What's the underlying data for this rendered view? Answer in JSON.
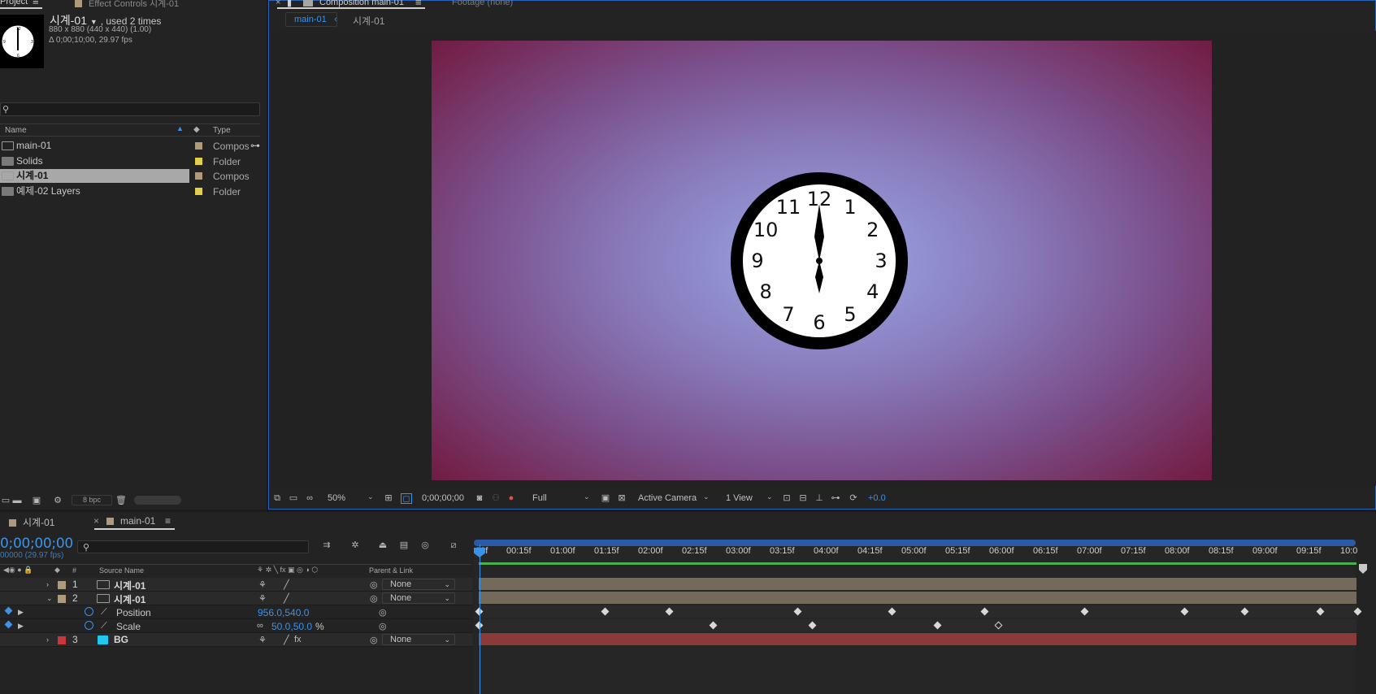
{
  "project": {
    "tab_project": "Project",
    "tab_effect": "Effect Controls 시계-01",
    "selected_name": "시계-01",
    "selected_used": ", used 2 times",
    "selected_size": "880 x 880  (440 x 440) (1.00)",
    "selected_duration": "Δ 0;00;10;00, 29.97 fps",
    "search_placeholder": "",
    "col_name": "Name",
    "col_type": "Type",
    "items": [
      {
        "name": "main-01",
        "type": "Compos",
        "kind": "comp",
        "label_color": "#b09a7c"
      },
      {
        "name": "Solids",
        "type": "Folder",
        "kind": "folder",
        "label_color": "#e2cf4a"
      },
      {
        "name": "시계-01",
        "type": "Compos",
        "kind": "comp",
        "label_color": "#b09a7c",
        "selected": true
      },
      {
        "name": "예제-02 Layers",
        "type": "Folder",
        "kind": "folder",
        "label_color": "#e2cf4a"
      }
    ],
    "bpc": "8 bpc"
  },
  "composition": {
    "tab_title": "Composition main-01",
    "tab_footage": "Footage (none)",
    "crumb_active": "main-01",
    "crumb_next": "시계-01",
    "zoom": "50%",
    "timecode": "0;00;00;00",
    "resolution": "Full",
    "camera": "Active Camera",
    "views": "1 View",
    "exposure": "+0.0"
  },
  "timeline": {
    "tab_other": "시계-01",
    "tab_active": "main-01",
    "current_time": "0;00;00;00",
    "fps_line": "00000 (29.97 fps)",
    "search_placeholder": "",
    "col_source": "Source Name",
    "col_parent": "Parent & Link",
    "col_num": "#",
    "ruler_labels": [
      "00f",
      "00:15f",
      "01:00f",
      "01:15f",
      "02:00f",
      "02:15f",
      "03:00f",
      "03:15f",
      "04:00f",
      "04:15f",
      "05:00f",
      "05:15f",
      "06:00f",
      "06:15f",
      "07:00f",
      "07:15f",
      "08:00f",
      "08:15f",
      "09:00f",
      "09:15f",
      "10:0"
    ],
    "layers": [
      {
        "num": "1",
        "name": "시계-01",
        "parent": "None",
        "label_color": "#b09a7c"
      },
      {
        "num": "2",
        "name": "시계-01",
        "parent": "None",
        "label_color": "#b09a7c"
      },
      {
        "num": "3",
        "name": "BG",
        "parent": "None",
        "label_color": "#c9363c"
      }
    ],
    "position": {
      "label": "Position",
      "value": "956.0,540.0"
    },
    "scale": {
      "label": "Scale",
      "value": "50.0,50.0",
      "unit": "%"
    }
  },
  "colors": {
    "accent": "#3d92e6",
    "bg_bar": "#8b3a3a",
    "layer_bar": "#736a5c",
    "work_area_green": "#4caf50"
  },
  "clock": {
    "numbers": [
      "12",
      "1",
      "2",
      "3",
      "4",
      "5",
      "6",
      "7",
      "8",
      "9",
      "10",
      "11"
    ]
  }
}
